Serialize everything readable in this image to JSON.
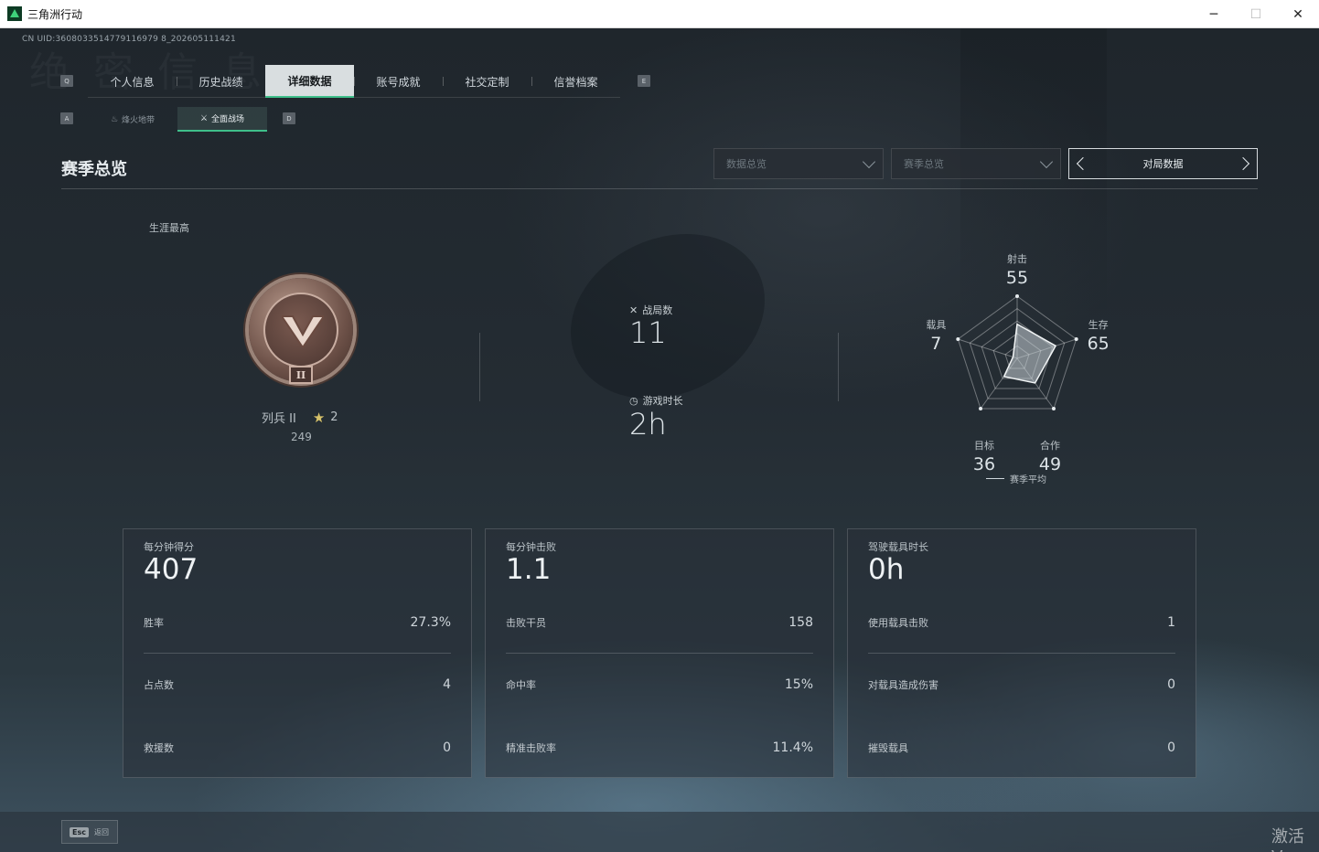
{
  "window": {
    "title": "三角洲行动",
    "controls": [
      "─",
      "☐",
      "✕"
    ]
  },
  "uid": "CN UID:3608033514779116979 8_202605111421",
  "watermark": "绝 密 信 息",
  "key_hints": {
    "prev_tab": "Q",
    "next_tab": "E",
    "prev_sub": "A",
    "next_sub": "D"
  },
  "tabs": [
    {
      "label": "个人信息",
      "active": false
    },
    {
      "label": "历史战绩",
      "active": false
    },
    {
      "label": "详细数据",
      "active": true
    },
    {
      "label": "账号成就",
      "active": false
    },
    {
      "label": "社交定制",
      "active": false
    },
    {
      "label": "信誉档案",
      "active": false
    }
  ],
  "subtabs": [
    {
      "label": "烽火地带",
      "icon": "flame-icon",
      "active": false
    },
    {
      "label": "全面战场",
      "icon": "battlefield-icon",
      "active": true
    }
  ],
  "section_title": "赛季总览",
  "dropdowns": [
    {
      "placeholder": "数据总览"
    },
    {
      "placeholder": "赛季总览"
    }
  ],
  "pager": {
    "label": "对局数据"
  },
  "career": {
    "label": "生涯最高",
    "rank_name": "列兵 II",
    "stars": "2",
    "score": "249",
    "badge_numeral": "II"
  },
  "overview": {
    "matches_label": "战局数",
    "matches_value": "11",
    "playtime_label": "游戏时长",
    "playtime_value": "2h"
  },
  "radar": {
    "axes": [
      {
        "label": "射击",
        "value": 55
      },
      {
        "label": "生存",
        "value": 65
      },
      {
        "label": "合作",
        "value": 49
      },
      {
        "label": "目标",
        "value": 36
      },
      {
        "label": "载具",
        "value": 7
      }
    ],
    "max": 100,
    "legend": "赛季平均"
  },
  "cards": [
    {
      "title": "每分钟得分",
      "value": "407",
      "rows": [
        {
          "label": "胜率",
          "value": "27.3%"
        },
        {
          "label": "占点数",
          "value": "4"
        },
        {
          "label": "救援数",
          "value": "0"
        }
      ]
    },
    {
      "title": "每分钟击败",
      "value": "1.1",
      "rows": [
        {
          "label": "击败干员",
          "value": "158"
        },
        {
          "label": "命中率",
          "value": "15%"
        },
        {
          "label": "精准击败率",
          "value": "11.4%"
        }
      ]
    },
    {
      "title": "驾驶载具时长",
      "value": "0h",
      "rows": [
        {
          "label": "使用载具击败",
          "value": "1"
        },
        {
          "label": "对载具造成伤害",
          "value": "0"
        },
        {
          "label": "摧毁载具",
          "value": "0"
        }
      ]
    }
  ],
  "footer": {
    "esc_key": "Esc",
    "esc_label": "返回"
  },
  "activate_text": "激活 V"
}
